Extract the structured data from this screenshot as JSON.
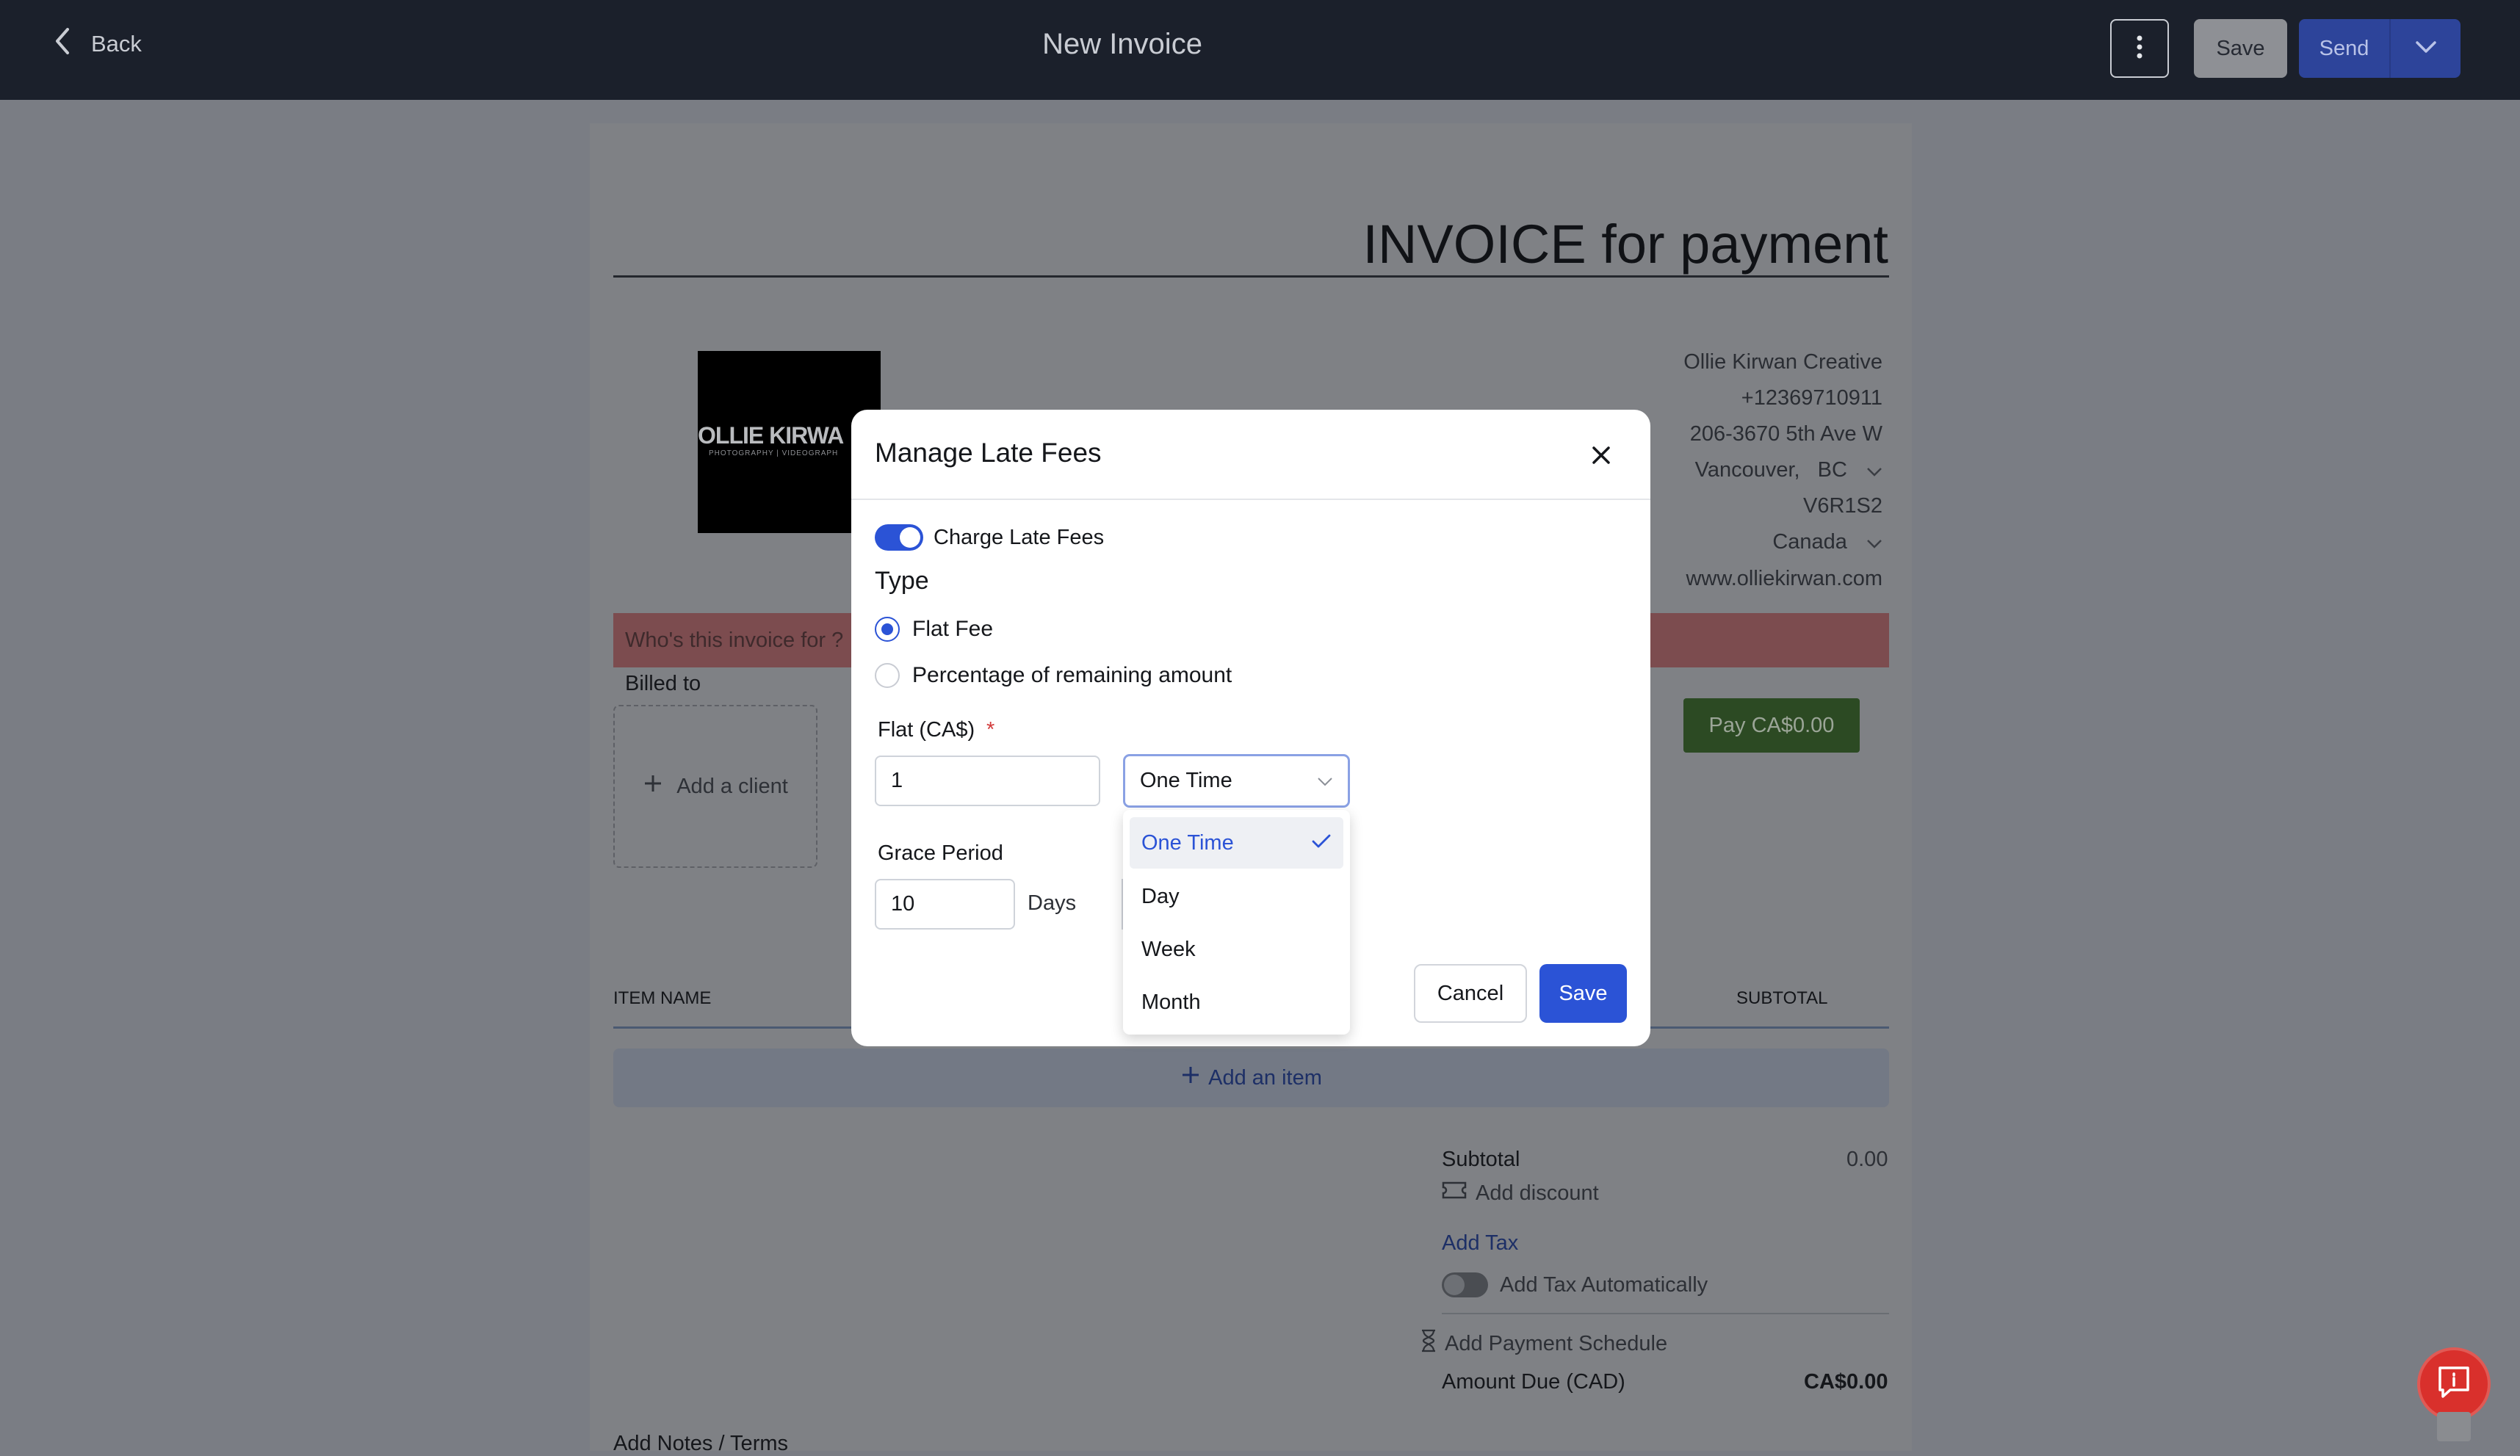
{
  "header": {
    "back_label": "Back",
    "title": "New Invoice",
    "save_label": "Save",
    "send_label": "Send"
  },
  "invoice": {
    "heading": "INVOICE for payment",
    "logo_text": "OLLIE KIRWA",
    "logo_subtext": "PHOTOGRAPHY | VIDEOGRAPH",
    "business": {
      "name": "Ollie Kirwan Creative",
      "phone": "+12369710911",
      "address": "206-3670 5th Ave W",
      "city": "Vancouver,",
      "province": "BC",
      "postal": "V6R1S2",
      "country": "Canada",
      "website": "www.olliekirwan.com"
    },
    "who_prompt": "Who's this invoice for ?",
    "billed_to": "Billed to",
    "add_client": "Add a client",
    "pay_button": "Pay CA$0.00",
    "col_item_name": "ITEM NAME",
    "col_subtotal": "SUBTOTAL",
    "add_item": "Add an item",
    "subtotal_label": "Subtotal",
    "subtotal_value": "0.00",
    "add_discount": "Add discount",
    "add_tax": "Add Tax",
    "add_tax_auto": "Add Tax Automatically",
    "add_payment_schedule": "Add Payment Schedule",
    "amount_due_label": "Amount Due (CAD)",
    "amount_due_value": "CA$0.00",
    "notes_label": "Add Notes / Terms"
  },
  "modal": {
    "title": "Manage Late Fees",
    "charge_late_fees": "Charge Late Fees",
    "type_heading": "Type",
    "type_flat": "Flat Fee",
    "type_percentage": "Percentage of remaining amount",
    "flat_label": "Flat (CA$)",
    "required_mark": "*",
    "flat_value": "1",
    "frequency_selected": "One Time",
    "grace_label": "Grace Period",
    "grace_value": "10",
    "days_label": "Days",
    "cancel_label": "Cancel",
    "save_label": "Save",
    "frequency_options": [
      "One Time",
      "Day",
      "Week",
      "Month"
    ]
  },
  "colors": {
    "accent": "#2b53d6",
    "topbar": "#1b202b",
    "help_button": "#d9302c"
  }
}
